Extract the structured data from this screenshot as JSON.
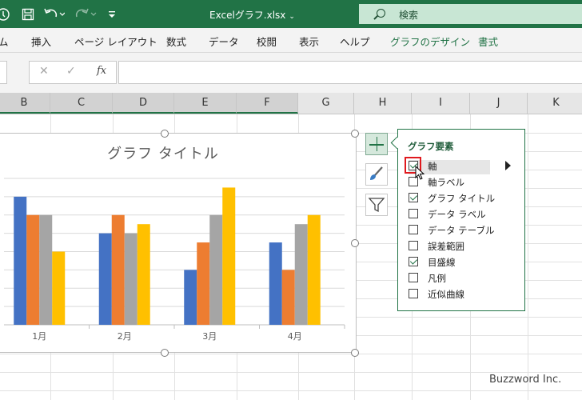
{
  "title_bar": {
    "file_name": "Excelグラフ.xlsx",
    "search_label": "検索",
    "save_icon": "save-icon",
    "undo_icon": "undo-icon",
    "redo_icon": "redo-icon"
  },
  "ribbon": {
    "tabs": [
      {
        "label": "ム",
        "contextual": false
      },
      {
        "label": "挿入",
        "contextual": false
      },
      {
        "label": "ページ レイアウト",
        "contextual": false
      },
      {
        "label": "数式",
        "contextual": false
      },
      {
        "label": "データ",
        "contextual": false
      },
      {
        "label": "校閲",
        "contextual": false
      },
      {
        "label": "表示",
        "contextual": false
      },
      {
        "label": "ヘルプ",
        "contextual": false
      },
      {
        "label": "グラフのデザイン",
        "contextual": true
      },
      {
        "label": "書式",
        "contextual": true
      }
    ]
  },
  "formula_bar": {
    "cancel": "✕",
    "enter": "✓",
    "fx": "fx",
    "value": ""
  },
  "columns": [
    "B",
    "C",
    "D",
    "E",
    "F",
    "G",
    "H",
    "I",
    "J",
    "K"
  ],
  "chart_data": {
    "type": "bar",
    "title": "グラフ タイトル",
    "categories": [
      "1月",
      "2月",
      "3月",
      "4月"
    ],
    "series": [
      {
        "values": [
          7,
          5,
          3,
          4.5
        ],
        "color": "#4472c4"
      },
      {
        "values": [
          6,
          6,
          4.5,
          3
        ],
        "color": "#ed7d31"
      },
      {
        "values": [
          6,
          5,
          6,
          5.5
        ],
        "color": "#a5a5a5"
      },
      {
        "values": [
          4,
          5.5,
          7.5,
          6
        ],
        "color": "#ffc000"
      }
    ],
    "ylim": [
      0,
      8
    ],
    "grid": true,
    "legend": "none"
  },
  "chart_elements_panel": {
    "title": "グラフ要素",
    "items": [
      {
        "label": "軸",
        "checked": true
      },
      {
        "label": "軸ラベル",
        "checked": false
      },
      {
        "label": "グラフ タイトル",
        "checked": true
      },
      {
        "label": "データ ラベル",
        "checked": false
      },
      {
        "label": "データ テーブル",
        "checked": false
      },
      {
        "label": "誤差範囲",
        "checked": false
      },
      {
        "label": "目盛線",
        "checked": true
      },
      {
        "label": "凡例",
        "checked": false
      },
      {
        "label": "近似曲線",
        "checked": false
      }
    ]
  },
  "watermark": "Buzzword Inc."
}
